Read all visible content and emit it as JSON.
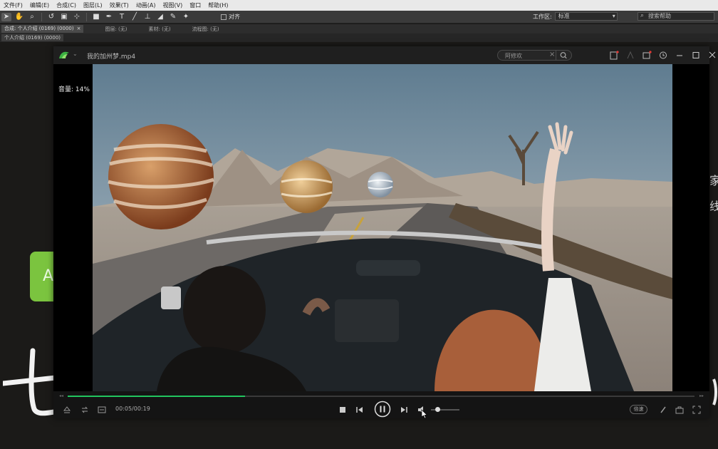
{
  "ae": {
    "menu": [
      "文件(F)",
      "编辑(E)",
      "合成(C)",
      "图层(L)",
      "效果(T)",
      "动画(A)",
      "视图(V)",
      "窗口",
      "帮助(H)"
    ],
    "align_label": "对齐",
    "workspace_label": "工作区:",
    "workspace_value": "标准",
    "help_placeholder": "搜索帮助",
    "comp_tab": "合成: 个人介绍 (0169) (0000)",
    "panel_tabs": [
      "图层: (无)",
      "素材: (无)",
      "流程图: (无)"
    ],
    "sub_tab": "个人介绍 (0169) (0000)"
  },
  "backdrop": {
    "chalk_letter": "A",
    "right_chars": [
      "家",
      "线"
    ]
  },
  "player": {
    "file_title": "我的加州梦.mp4",
    "search_query": "阿修欢",
    "volume_tip": "音量: 14%",
    "time": "00:05/00:19",
    "progress": 0.27,
    "volume": 0.14,
    "speed_label": "倍速",
    "accent": "#22c55e"
  }
}
